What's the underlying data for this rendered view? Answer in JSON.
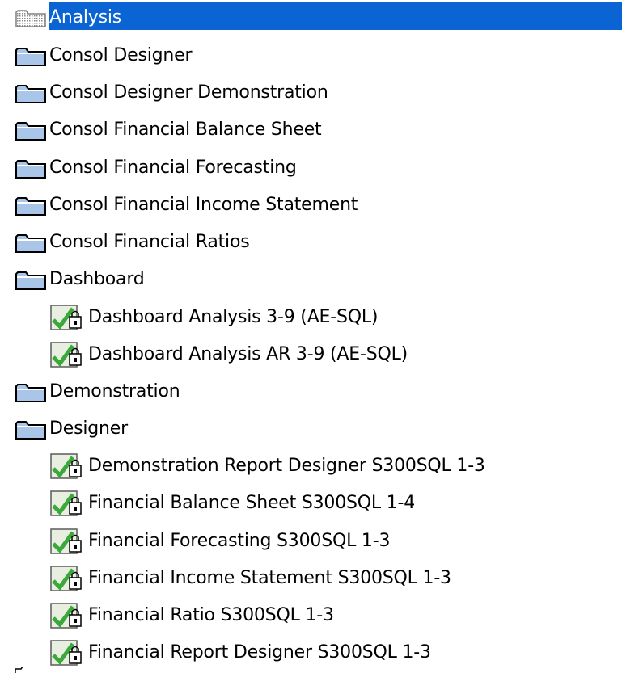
{
  "tree": {
    "items": [
      {
        "label": "Analysis",
        "level": 0,
        "type": "folder-dotted",
        "selected": true
      },
      {
        "label": "Consol Designer",
        "level": 0,
        "type": "folder"
      },
      {
        "label": "Consol Designer Demonstration",
        "level": 0,
        "type": "folder"
      },
      {
        "label": "Consol Financial Balance Sheet",
        "level": 0,
        "type": "folder"
      },
      {
        "label": "Consol Financial Forecasting",
        "level": 0,
        "type": "folder"
      },
      {
        "label": "Consol Financial Income Statement",
        "level": 0,
        "type": "folder"
      },
      {
        "label": "Consol Financial Ratios",
        "level": 0,
        "type": "folder"
      },
      {
        "label": "Dashboard",
        "level": 0,
        "type": "folder"
      },
      {
        "label": "Dashboard Analysis 3-9 (AE-SQL)",
        "level": 1,
        "type": "report"
      },
      {
        "label": "Dashboard Analysis AR 3-9 (AE-SQL)",
        "level": 1,
        "type": "report"
      },
      {
        "label": "Demonstration",
        "level": 0,
        "type": "folder"
      },
      {
        "label": "Designer",
        "level": 0,
        "type": "folder"
      },
      {
        "label": "Demonstration Report Designer S300SQL 1-3",
        "level": 1,
        "type": "report"
      },
      {
        "label": "Financial Balance Sheet S300SQL 1-4",
        "level": 1,
        "type": "report"
      },
      {
        "label": "Financial Forecasting S300SQL 1-3",
        "level": 1,
        "type": "report"
      },
      {
        "label": "Financial Income Statement S300SQL 1-3",
        "level": 1,
        "type": "report"
      },
      {
        "label": "Financial Ratio S300SQL 1-3",
        "level": 1,
        "type": "report"
      },
      {
        "label": "Financial Report Designer S300SQL 1-3",
        "level": 1,
        "type": "report"
      }
    ]
  },
  "colors": {
    "selection": "#0a64d4",
    "folder_fill": "#a9c6e8",
    "folder_outline": "#000000",
    "report_green": "#3aa83a"
  }
}
